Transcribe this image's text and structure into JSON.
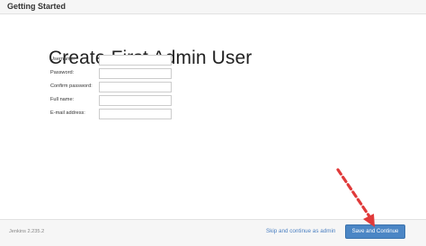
{
  "header": {
    "title": "Getting Started"
  },
  "main": {
    "title": "Create First Admin User",
    "fields": [
      {
        "label": "Username:",
        "value": ""
      },
      {
        "label": "Password:",
        "value": ""
      },
      {
        "label": "Confirm password:",
        "value": ""
      },
      {
        "label": "Full name:",
        "value": ""
      },
      {
        "label": "E-mail address:",
        "value": ""
      }
    ]
  },
  "footer": {
    "version": "Jenkins 2.235.2",
    "skip_label": "Skip and continue as admin",
    "save_label": "Save and Continue"
  },
  "colors": {
    "accent": "#4b86c5",
    "annotation": "#e03a3a"
  },
  "annotation": {
    "icon": "dashed-arrow-icon"
  }
}
